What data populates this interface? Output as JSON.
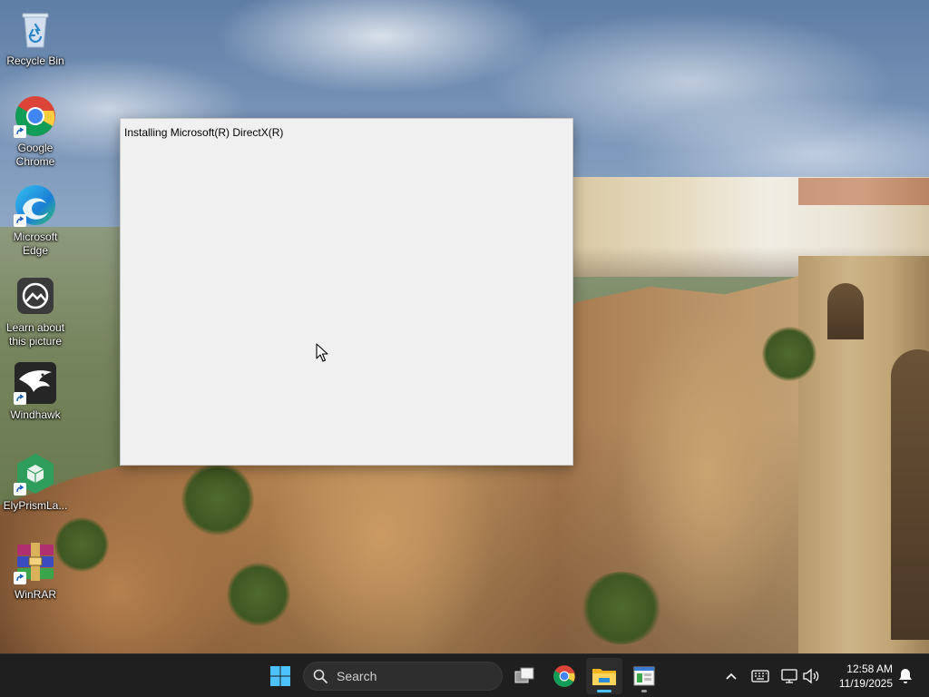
{
  "desktop": {
    "icons": [
      {
        "label": "Recycle Bin"
      },
      {
        "label": "Google Chrome"
      },
      {
        "label": "Microsoft Edge"
      },
      {
        "label": "Learn about this picture"
      },
      {
        "label": "Windhawk"
      },
      {
        "label": "ElyPrismLa..."
      },
      {
        "label": "WinRAR"
      }
    ]
  },
  "window": {
    "title": "Installing Microsoft(R) DirectX(R)"
  },
  "taskbar": {
    "search_label": "Search",
    "apps": [
      "start-icon",
      "task-view-icon",
      "chrome-icon",
      "file-explorer-icon",
      "directx-setup-icon"
    ],
    "tray": [
      "chevron-up-icon",
      "keyboard-icon",
      "network-icon",
      "volume-icon",
      "notification-icon"
    ],
    "clock": {
      "time": "12:58 AM",
      "date": "11/19/2025"
    }
  },
  "colors": {
    "taskbar_bg": "#1f1f1f",
    "window_bg": "#f0f0f0",
    "accent": "#4cc2ff"
  }
}
